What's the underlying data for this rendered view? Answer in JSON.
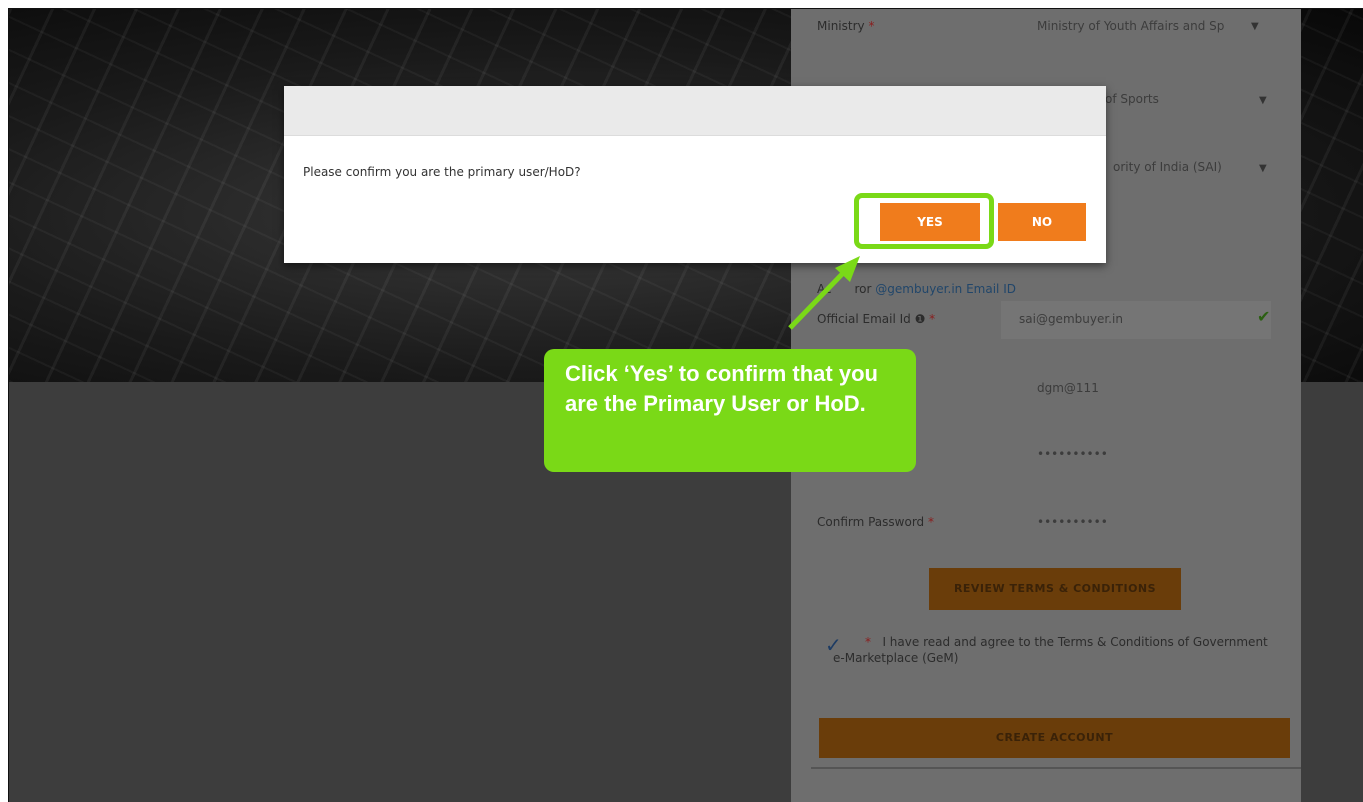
{
  "form": {
    "ministry_label": "Ministry",
    "ministry_value": "Ministry of Youth Affairs and Sp",
    "department_value": "of Sports",
    "organisation_value": "ority of India (SAI)",
    "email_helper_prefix": "Ac",
    "email_helper_middle": "ror",
    "email_helper_domain": "@gembuyer.in",
    "email_helper_suffix": "Email ID",
    "official_email_label": "Official Email Id",
    "official_email_value": "sai@gembuyer.in",
    "user_id_value": "dgm@111",
    "password_value": "••••••••••",
    "confirm_password_label": "Confirm Password",
    "confirm_password_value": "••••••••••",
    "terms_button_label": "REVIEW TERMS & CONDITIONS",
    "agree_text": "I have read and agree to the Terms & Conditions of Government e-Marketplace (GeM)",
    "create_button_label": "CREATE ACCOUNT",
    "required_mark": "*"
  },
  "modal": {
    "message": "Please confirm you are the primary user/HoD?",
    "yes_label": "YES",
    "no_label": "NO"
  },
  "callout": {
    "text": "Click ‘Yes’ to confirm that you are the Primary User or HoD."
  },
  "colors": {
    "accent_orange": "#f07c1c",
    "highlight_green": "#7ad917"
  }
}
